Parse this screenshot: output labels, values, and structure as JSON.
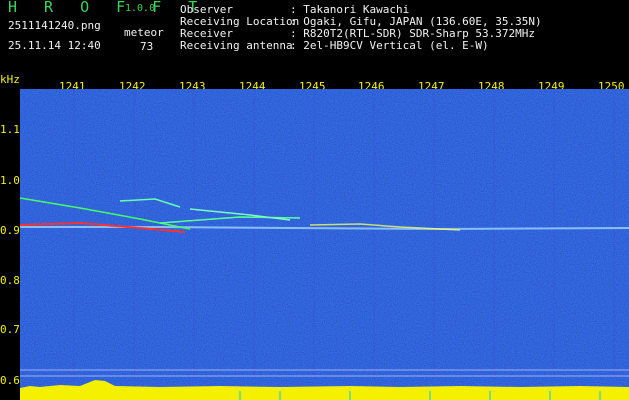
{
  "app": {
    "logo": "H R O F F T",
    "version": "1.0.0"
  },
  "file": {
    "name": "2511141240.png",
    "datetime": "25.11.14 12:40"
  },
  "meteor": {
    "label": "meteor",
    "count": "73"
  },
  "info": [
    {
      "label": "Observer",
      "value": ": Takanori Kawachi"
    },
    {
      "label": "Receiving Location",
      "value": ": Ogaki, Gifu, JAPAN (136.60E, 35.35N)"
    },
    {
      "label": "Receiver",
      "value": ": R820T2(RTL-SDR) SDR-Sharp 53.372MHz"
    },
    {
      "label": "Receiving antenna",
      "value": ": 2el-HB9CV Vertical (el. E-W)"
    }
  ],
  "axis": {
    "y_unit": "kHz",
    "x_ticks": [
      "1241",
      "1242",
      "1243",
      "1244",
      "1245",
      "1246",
      "1247",
      "1248",
      "1249",
      "1250"
    ],
    "y_ticks": [
      "1.1",
      "1.0",
      "0.9",
      "0.8",
      "0.7",
      "0.6"
    ]
  },
  "colors": {
    "background": "#000000",
    "spectrogram_base": "#0a1a8c",
    "signal": "#ff3030",
    "baseline": "#f4f000"
  }
}
